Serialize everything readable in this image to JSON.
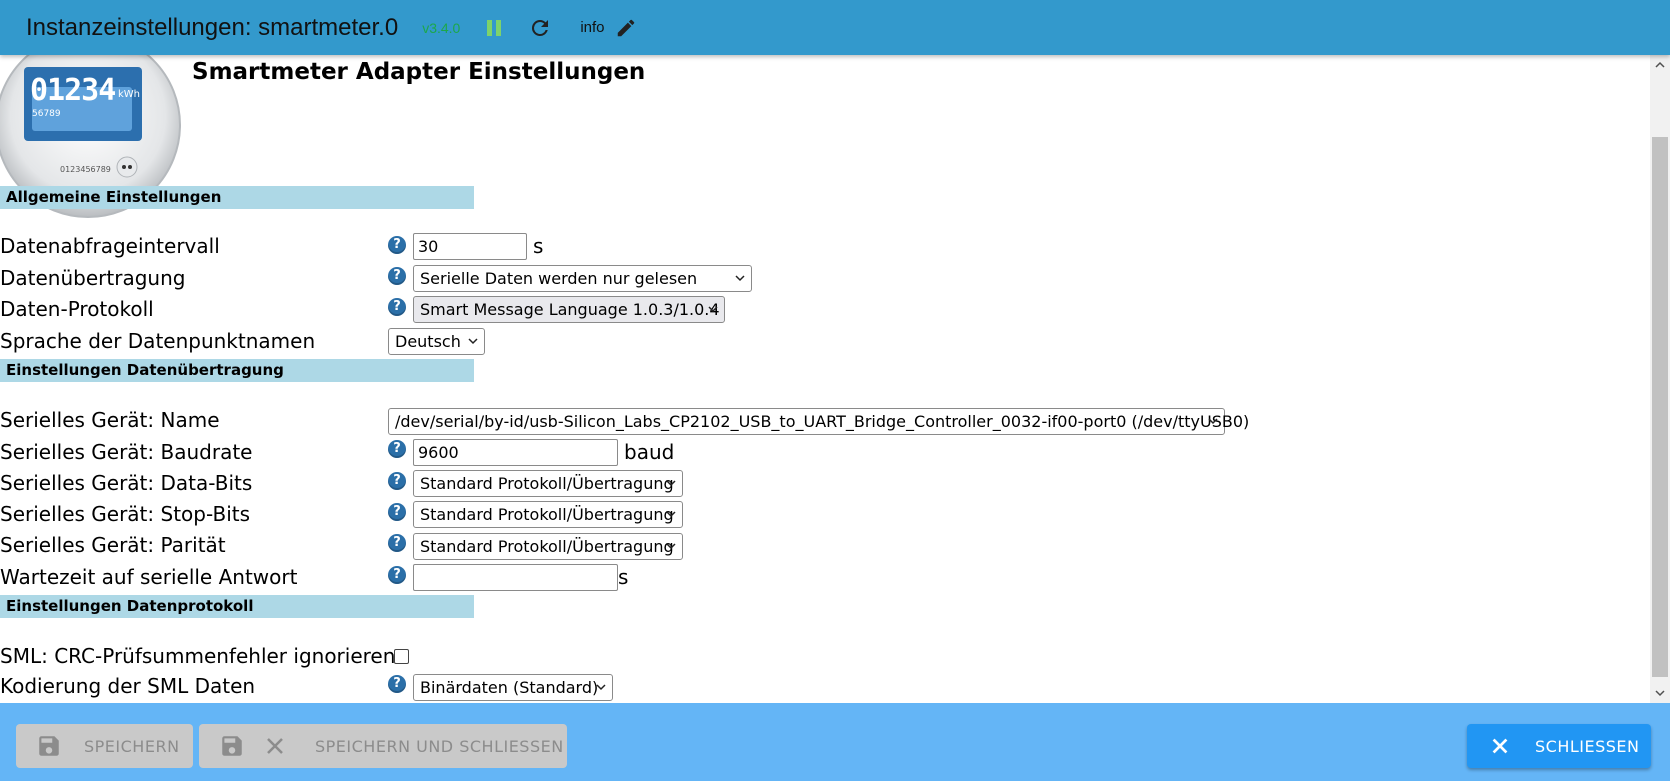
{
  "header": {
    "title": "Instanzeinstellungen: smartmeter.0",
    "version": "v3.4.0",
    "info_label": "info",
    "icons": [
      "pause-icon",
      "refresh-icon",
      "edit-icon"
    ]
  },
  "page": {
    "title": "Smartmeter Adapter Einstellungen",
    "logo": {
      "display_value": "01234",
      "unit": "kWh",
      "sub_value": "56789",
      "serial": "0123456789"
    }
  },
  "sections": {
    "general": {
      "header": "Allgemeine Einstellungen",
      "interval_label": "Datenabfrageintervall",
      "interval_value": "30",
      "interval_unit": "s",
      "transfer_label": "Datenübertragung",
      "transfer_value": "Serielle Daten werden nur gelesen",
      "protocol_label": "Daten-Protokoll",
      "protocol_value": "Smart Message Language 1.0.3/1.0.4",
      "language_label": "Sprache der Datenpunktnamen",
      "language_value": "Deutsch"
    },
    "transfer": {
      "header": "Einstellungen Datenübertragung",
      "device_label": "Serielles Gerät: Name",
      "device_value": "/dev/serial/by-id/usb-Silicon_Labs_CP2102_USB_to_UART_Bridge_Controller_0032-if00-port0 (/dev/ttyUSB0)",
      "baud_label": "Serielles Gerät: Baudrate",
      "baud_value": "9600",
      "baud_unit": "baud",
      "databits_label": "Serielles Gerät: Data-Bits",
      "databits_value": "Standard Protokoll/Übertragung",
      "stopbits_label": "Serielles Gerät: Stop-Bits",
      "stopbits_value": "Standard Protokoll/Übertragung",
      "parity_label": "Serielles Gerät: Parität",
      "parity_value": "Standard Protokoll/Übertragung",
      "wait_label": "Wartezeit auf serielle Antwort",
      "wait_value": "",
      "wait_unit": "s"
    },
    "protocol": {
      "header": "Einstellungen Datenprotokoll",
      "crc_label": "SML: CRC-Prüfsummenfehler ignorieren",
      "crc_checked": false,
      "encoding_label": "Kodierung der SML Daten",
      "encoding_value": "Binärdaten (Standard)"
    }
  },
  "help_glyph": "?",
  "footer": {
    "save_label": "SPEICHERN",
    "save_close_label": "SPEICHERN UND SCHLIESSEN",
    "close_label": "SCHLIESSEN"
  },
  "colors": {
    "header_bg": "#3399cc",
    "section_bg": "#add8e6",
    "footer_bg": "#64b5f6",
    "primary_button": "#2196f3",
    "version_text": "#1ca84a",
    "help_icon": "#2b6fa8"
  }
}
